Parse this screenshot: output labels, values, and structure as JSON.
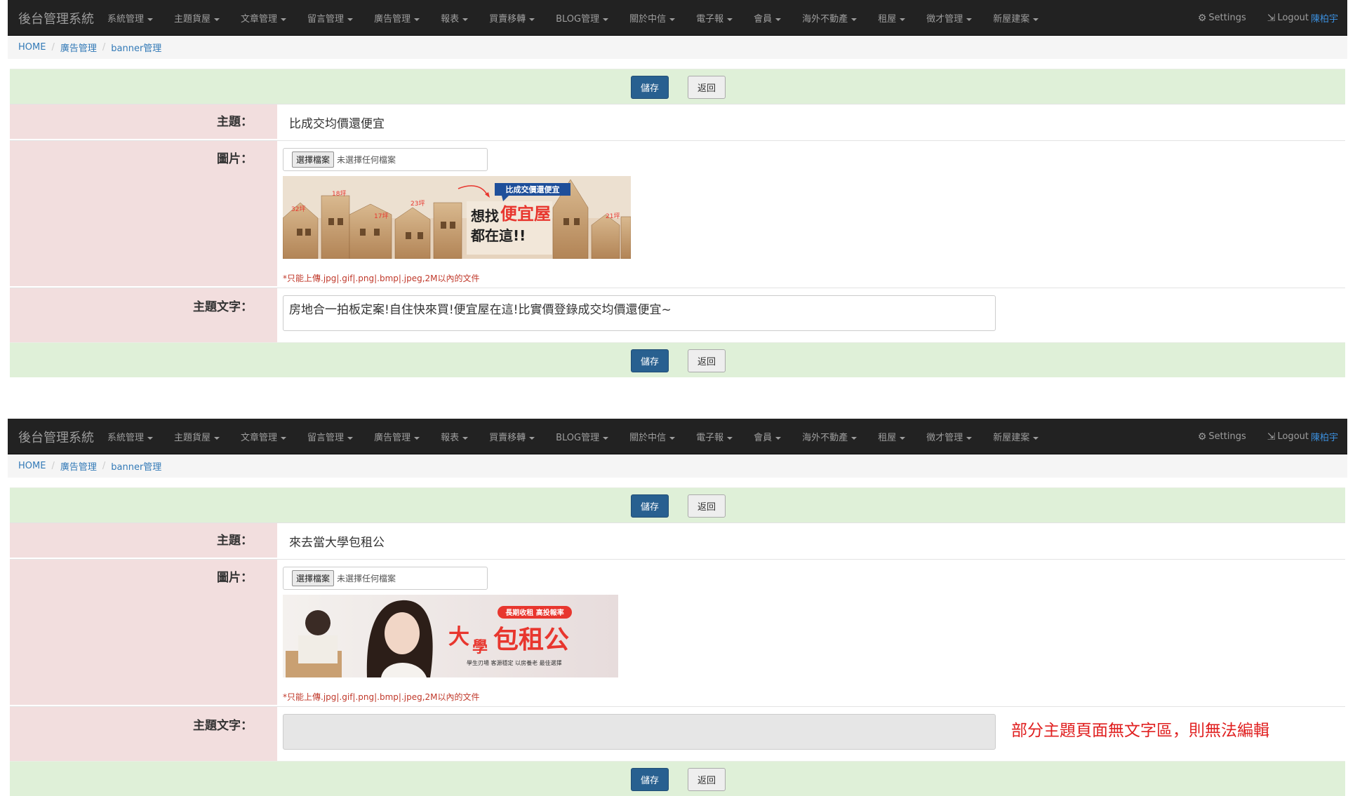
{
  "screens": [
    {
      "navbar": {
        "brand": "後台管理系統",
        "menu": [
          "系統管理",
          "主題貨屋",
          "文章管理",
          "留言管理",
          "廣告管理",
          "報表",
          "買賣移轉",
          "BLOG管理",
          "關於中信",
          "電子報",
          "會員",
          "海外不動產",
          "租屋",
          "徵才管理",
          "新屋建案"
        ],
        "settings_label": "Settings",
        "logout_label": "Logout",
        "username": "陳柏宇"
      },
      "breadcrumb": [
        "HOME",
        "廣告管理",
        "banner管理"
      ],
      "buttons": {
        "save": "儲存",
        "back": "返回"
      },
      "form": {
        "subject_label": "主題：",
        "subject_value": "比成交均價還便宜",
        "image_label": "圖片：",
        "file_button": "選擇檔案",
        "file_status": "未選擇任何檔案",
        "upload_note": "*只能上傳.jpg|.gif|.png|.bmp|.jpeg,2M以內的文件",
        "subject_text_label": "主題文字：",
        "subject_text_value": "房地合一拍板定案!自住快來買!便宜屋在這!比實價登錄成交均價還便宜~"
      },
      "banner": {
        "tag": "比成交價還便宜",
        "headline_1": "想找",
        "headline_highlight": "便宜屋",
        "headline_2": "都在這!!",
        "sizes": [
          "32坪",
          "18坪",
          "17坪",
          "23坪",
          "21坪"
        ]
      }
    },
    {
      "navbar": {
        "brand": "後台管理系統",
        "menu": [
          "系統管理",
          "主題貨屋",
          "文章管理",
          "留言管理",
          "廣告管理",
          "報表",
          "買賣移轉",
          "BLOG管理",
          "關於中信",
          "電子報",
          "會員",
          "海外不動產",
          "租屋",
          "徵才管理",
          "新屋建案"
        ],
        "settings_label": "Settings",
        "logout_label": "Logout",
        "username": "陳柏宇"
      },
      "breadcrumb": [
        "HOME",
        "廣告管理",
        "banner管理"
      ],
      "buttons": {
        "save": "儲存",
        "back": "返回"
      },
      "form": {
        "subject_label": "主題：",
        "subject_value": "來去當大學包租公",
        "image_label": "圖片：",
        "file_button": "選擇檔案",
        "file_status": "未選擇任何檔案",
        "upload_note": "*只能上傳.jpg|.gif|.png|.bmp|.jpeg,2M以內的文件",
        "subject_text_label": "主題文字：",
        "subject_text_value": "",
        "warning": "部分主題頁面無文字區，則無法編輯"
      },
      "banner": {
        "tag": "長期收租 高投報率",
        "big_1": "大",
        "big_2": "學",
        "big_3": "包租公",
        "subline": "學生刃場 客源穩定 以房養老 最佳選擇"
      }
    }
  ],
  "colors": {
    "navbar_bg": "#222222",
    "primary_button": "#286090",
    "label_bg": "#f2dede",
    "action_row_bg": "#dff0d8",
    "warning_text": "#e02020",
    "banner_red": "#e8362e"
  }
}
